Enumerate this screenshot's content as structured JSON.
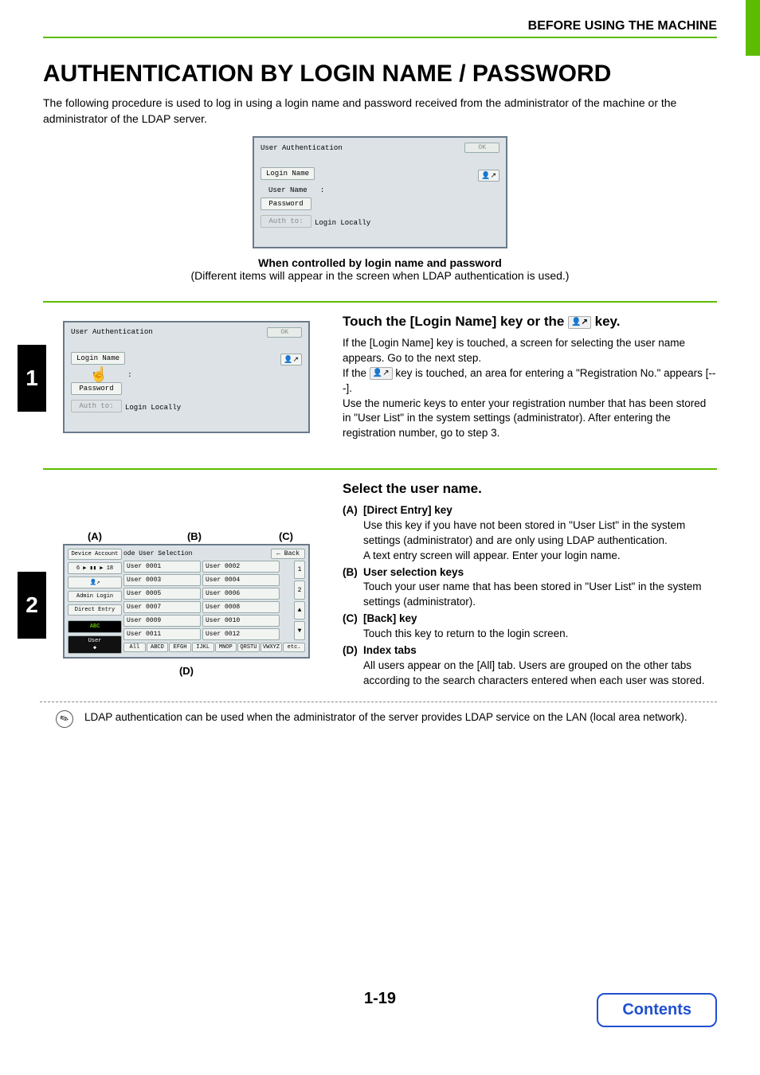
{
  "header": {
    "section": "BEFORE USING THE MACHINE"
  },
  "title": "AUTHENTICATION BY LOGIN NAME / PASSWORD",
  "intro": "The following procedure is used to log in using a login name and password received from the administrator of the machine or the administrator of the LDAP server.",
  "mockup_top": {
    "title": "User Authentication",
    "ok": "OK",
    "login_name": "Login Name",
    "user_name": "User Name",
    "colon": ":",
    "password": "Password",
    "auth_to": "Auth to:",
    "auth_target": "Login Locally"
  },
  "caption": {
    "bold": "When controlled by login name and password",
    "note": "(Different items will appear in the screen when LDAP authentication is used.)"
  },
  "step1": {
    "num": "1",
    "heading_a": "Touch the [Login Name] key or the ",
    "heading_b": " key.",
    "text1": "If the [Login Name] key is touched, a screen for selecting the user name appears. Go to the next step.",
    "text2a": "If the ",
    "text2b": " key is touched, an area for entering a \"Registration No.\" appears [---].",
    "text3": "Use the numeric keys to enter your registration number that has been stored in \"User List\" in the system settings (administrator). After entering the registration number, go to step 3."
  },
  "step2": {
    "num": "2",
    "labels": {
      "a": "(A)",
      "b": "(B)",
      "c": "(C)",
      "d": "(D)"
    },
    "heading": "Select the user name.",
    "mock": {
      "device_account": "Device Account",
      "ode_sel": "ode User Selection",
      "back": "Back",
      "crumb": "6 ▶ ▮▮ ▶ 18",
      "admin": "Admin Login",
      "direct": "Direct Entry",
      "abc": "ABC",
      "user": "User",
      "page1": "1",
      "page2": "2",
      "up": "▲",
      "down": "▼",
      "users": [
        "User 0001",
        "User 0002",
        "User 0003",
        "User 0004",
        "User 0005",
        "User 0006",
        "User 0007",
        "User 0008",
        "User 0009",
        "User 0010",
        "User 0011",
        "User 0012"
      ],
      "tabs": [
        "All",
        "ABCD",
        "EFGH",
        "IJKL",
        "MNOP",
        "QRSTU",
        "VWXYZ",
        "etc."
      ]
    },
    "defs": {
      "a_title": "[Direct Entry] key",
      "a_text1": "Use this key if you have not been stored in \"User List\" in the system settings (administrator) and are only using LDAP authentication.",
      "a_text2": "A text entry screen will appear. Enter your login name.",
      "b_title": "User selection keys",
      "b_text": "Touch your user name that has been stored in \"User List\" in the system settings (administrator).",
      "c_title": "[Back] key",
      "c_text": "Touch this key to return to the login screen.",
      "d_title": "Index tabs",
      "d_text": "All users appear on the [All] tab. Users are grouped on the other tabs according to the search characters entered when each user was stored."
    },
    "note": "LDAP authentication can be used when the administrator of the server provides LDAP service on the LAN (local area network)."
  },
  "pageno": "1-19",
  "contents": "Contents",
  "icons": {
    "user_arrow": "👤↗",
    "pencil": "✎"
  }
}
